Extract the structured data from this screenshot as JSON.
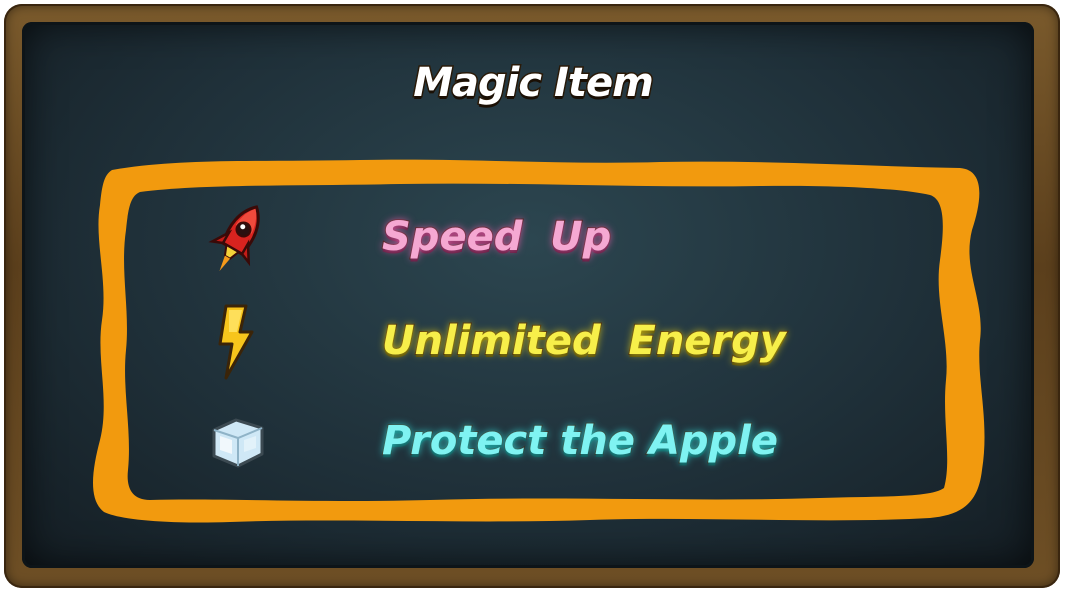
{
  "title": "Magic Item",
  "items": [
    {
      "icon": "rocket-icon",
      "label": "Speed  Up",
      "color": "#f5a8d2"
    },
    {
      "icon": "lightning-bolt-icon",
      "label": "Unlimited  Energy",
      "color": "#f7ef4a"
    },
    {
      "icon": "ice-cube-icon",
      "label": "Protect the Apple",
      "color": "#7ff3f2"
    }
  ],
  "colors": {
    "frame_wood": "#6e4f25",
    "chalkboard": "#1f3039",
    "border_orange": "#f29a0e"
  }
}
